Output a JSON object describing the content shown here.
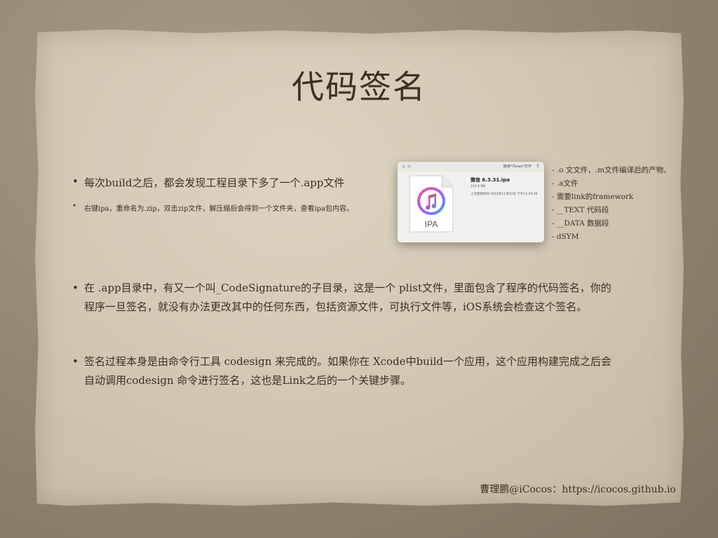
{
  "slide": {
    "title": "代码签名",
    "bullets": [
      {
        "text": "每次build之后，都会发现工程目录下多了一个.app文件"
      },
      {
        "text": "右键ipa，重命名为.zip，双击zip文件，解压缩后会得到一个文件夹，查看ipa包内容。"
      },
      {
        "lines": [
          "在 .app目录中，有又一个叫_CodeSignature的子目录，这是一个 plist文件，里面包含了程序的代码签名，你的",
          "程序一旦签名，就没有办法更改其中的任何东西，包括资源文件，可执行文件等，iOS系统会检查这个签名。"
        ]
      },
      {
        "lines": [
          "签名过程本身是由命令行工具 codesign 来完成的。如果你在 Xcode中build一个应用，这个应用构建完成之后会",
          "自动调用codesign 命令进行签名，这也是Link之后的一个关键步骤。"
        ]
      }
    ],
    "bullet_symbol": "•",
    "notes": [
      "- .o 文文件，.m文件编译后的产物。",
      "- .a文件",
      "-  需要link的framework",
      "-  __TEXT 代码段",
      "-  __DATA 数据段",
      "-  dSYM"
    ],
    "footer": "曹理鹏@iCocos：https://icocos.github.io"
  },
  "finder": {
    "open_with": "使用\"iTunes\"打开",
    "share_icon": "share-icon",
    "file_name": "微信 6.3.31.ipa",
    "file_size": "124.8 MB",
    "file_date": "上次修改时间 2016年11月22日 下午11:29:46",
    "icon_label": "IPA",
    "icon": "itunes-music-icon"
  }
}
